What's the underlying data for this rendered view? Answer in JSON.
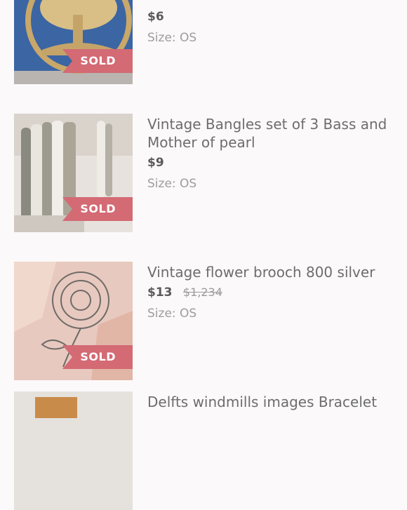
{
  "listings": [
    {
      "title": "",
      "price": "$6",
      "original_price": "",
      "size": "Size: OS",
      "badge": "SOLD"
    },
    {
      "title": "Vintage Bangles set of 3 Bass and Mother of pearl",
      "price": "$9",
      "original_price": "",
      "size": "Size: OS",
      "badge": "SOLD"
    },
    {
      "title": "Vintage flower brooch 800 silver",
      "price": "$13",
      "original_price": "$1,234",
      "size": "Size: OS",
      "badge": "SOLD"
    },
    {
      "title": "Delfts windmills images Bracelet",
      "price": "",
      "original_price": "",
      "size": "",
      "badge": ""
    }
  ],
  "colors": {
    "sold_badge": "#d36a74",
    "background": "#fbf9fa",
    "price": "#5a5a5a"
  }
}
